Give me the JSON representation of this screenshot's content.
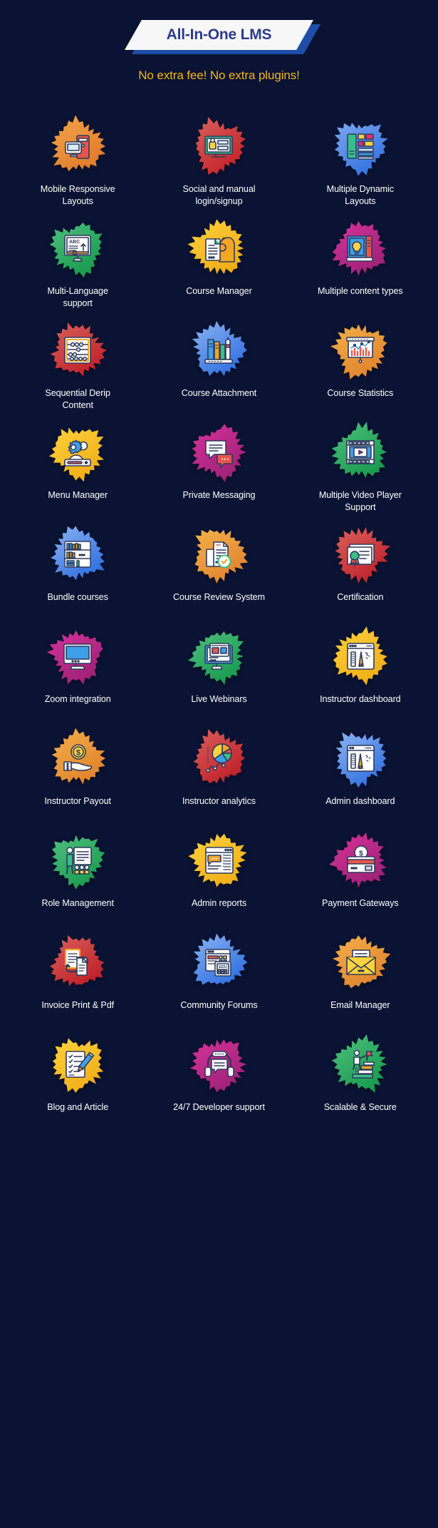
{
  "header": {
    "banner_title": "All-In-One LMS",
    "subtitle": "No extra fee! No extra plugins!",
    "banner_bg": "#f7f7f7",
    "banner_shadow": "#1f4ea8",
    "title_color": "#2b3a8f",
    "subtitle_color": "#f5b716"
  },
  "theme": {
    "background": "#0a1333",
    "caption_color": "#ffffff"
  },
  "features": [
    {
      "label": "Mobile Responsive Layouts",
      "icon": "mobile-responsive-layouts-icon",
      "blob_from": "#f3a64b",
      "blob_to": "#e07a2c"
    },
    {
      "label": "Social and manual login/signup",
      "icon": "lock-monitor-login-icon",
      "blob_from": "#d9615c",
      "blob_to": "#c41f28"
    },
    {
      "label": "Multiple Dynamic Layouts",
      "icon": "dynamic-layouts-icon",
      "blob_from": "#7ea7ee",
      "blob_to": "#2f6fe0"
    },
    {
      "label": "Multi-Language support",
      "icon": "abc-monitor-language-icon",
      "blob_from": "#4fc07e",
      "blob_to": "#179a4e"
    },
    {
      "label": "Course Manager",
      "icon": "head-document-manager-icon",
      "blob_from": "#ffd23f",
      "blob_to": "#f0ad16"
    },
    {
      "label": "Multiple content types",
      "icon": "book-lightbulb-icon",
      "blob_from": "#d8339b",
      "blob_to": "#9c2176"
    },
    {
      "label": "Sequential Derip Content",
      "icon": "abacus-sequential-icon",
      "blob_from": "#d9615c",
      "blob_to": "#bf1f28"
    },
    {
      "label": "Course Attachment",
      "icon": "bookshelf-attachment-icon",
      "blob_from": "#8cb4f2",
      "blob_to": "#2f6fe0"
    },
    {
      "label": "Course Statistics",
      "icon": "chart-board-statistics-icon",
      "blob_from": "#f3b04b",
      "blob_to": "#e0822c"
    },
    {
      "label": "Menu Manager",
      "icon": "gear-menu-manager-icon",
      "blob_from": "#ffd23f",
      "blob_to": "#f0ad16"
    },
    {
      "label": "Private Messaging",
      "icon": "chat-bubbles-messaging-icon",
      "blob_from": "#d8339b",
      "blob_to": "#9c2176"
    },
    {
      "label": "Multiple Video Player Support",
      "icon": "film-video-player-icon",
      "blob_from": "#4fc07e",
      "blob_to": "#179a4e"
    },
    {
      "label": "Bundle courses",
      "icon": "bookshelf-bundle-icon",
      "blob_from": "#8cb4f2",
      "blob_to": "#2f6fe0"
    },
    {
      "label": "Course Review System",
      "icon": "document-check-review-icon",
      "blob_from": "#f3b04b",
      "blob_to": "#e0822c"
    },
    {
      "label": "Certification",
      "icon": "certificate-ribbon-icon",
      "blob_from": "#d9615c",
      "blob_to": "#bf1f28"
    },
    {
      "label": "Zoom integration",
      "icon": "monitor-zoom-icon",
      "blob_from": "#d8339b",
      "blob_to": "#9c2176"
    },
    {
      "label": "Live Webinars",
      "icon": "monitor-webinar-icon",
      "blob_from": "#4fc07e",
      "blob_to": "#179a4e"
    },
    {
      "label": "Instructor dashboard",
      "icon": "instructor-dashboard-icon",
      "blob_from": "#ffd23f",
      "blob_to": "#f0ad16"
    },
    {
      "label": "Instructor Payout",
      "icon": "hand-coin-payout-icon",
      "blob_from": "#f3b04b",
      "blob_to": "#e0822c"
    },
    {
      "label": "Instructor analytics",
      "icon": "pie-chart-analytics-icon",
      "blob_from": "#d9615c",
      "blob_to": "#bf1f28"
    },
    {
      "label": "Admin dashboard",
      "icon": "admin-dashboard-icon",
      "blob_from": "#8cb4f2",
      "blob_to": "#2f6fe0"
    },
    {
      "label": "Role Management",
      "icon": "person-board-role-icon",
      "blob_from": "#4fc07e",
      "blob_to": "#179a4e"
    },
    {
      "label": "Admin reports",
      "icon": "report-document-icon",
      "blob_from": "#ffd23f",
      "blob_to": "#f0ad16"
    },
    {
      "label": "Payment Gateways",
      "icon": "card-coin-payment-icon",
      "blob_from": "#d8339b",
      "blob_to": "#9c2176"
    },
    {
      "label": "Invoice Print & Pdf",
      "icon": "invoice-print-pdf-icon",
      "blob_from": "#d9615c",
      "blob_to": "#bf1f28"
    },
    {
      "label": "Community Forums",
      "icon": "community-forums-icon",
      "blob_from": "#8cb4f2",
      "blob_to": "#2f6fe0"
    },
    {
      "label": "Email Manager",
      "icon": "envelope-email-icon",
      "blob_from": "#f3b04b",
      "blob_to": "#e0822c"
    },
    {
      "label": "Blog and Article",
      "icon": "checklist-pencil-blog-icon",
      "blob_from": "#ffd23f",
      "blob_to": "#f0ad16"
    },
    {
      "label": "24/7 Developer support",
      "icon": "headset-support-icon",
      "blob_from": "#d8339b",
      "blob_to": "#9c2176"
    },
    {
      "label": "Scalable & Secure",
      "icon": "books-flag-scalable-icon",
      "blob_from": "#4fc07e",
      "blob_to": "#179a4e"
    }
  ]
}
